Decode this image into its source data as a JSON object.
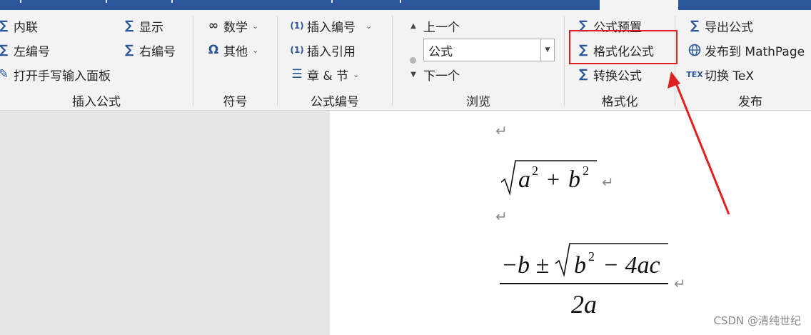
{
  "ribbon": {
    "insert_group": {
      "inline": "内联",
      "left_number": "左编号",
      "open_handwriting": "打开手写输入面板",
      "display": "显示",
      "right_number": "右编号",
      "label": "插入公式"
    },
    "symbol_group": {
      "math": "数学",
      "other": "其他",
      "label": "符号"
    },
    "numbering_group": {
      "insert_number": "插入编号",
      "insert_reference": "插入引用",
      "chapter_section": "章 & 节",
      "label": "公式编号"
    },
    "browse_group": {
      "previous": "上一个",
      "combo_value": "公式",
      "next": "下一个",
      "label": "浏览"
    },
    "format_group": {
      "equation_preset": "公式预置",
      "format_equation": "格式化公式",
      "convert_equation": "转换公式",
      "label": "格式化"
    },
    "publish_group": {
      "export_equation": "导出公式",
      "publish_mathpage": "发布到 MathPage",
      "toggle_tex": "切换 TeX",
      "label": "发布"
    }
  },
  "document": {
    "paragraph_mark": "↵",
    "equation1": {
      "base_a": "a",
      "exp_a": "2",
      "plus": "+",
      "base_b": "b",
      "exp_b": "2"
    },
    "equation2": {
      "minus_b": "−b ±",
      "radicand_b": "b",
      "exp": "2",
      "rest": "− 4ac",
      "denominator": "2a"
    }
  },
  "watermark": "CSDN @清纯世纪",
  "colors": {
    "accent": "#2b579a",
    "highlight": "#e02020"
  }
}
